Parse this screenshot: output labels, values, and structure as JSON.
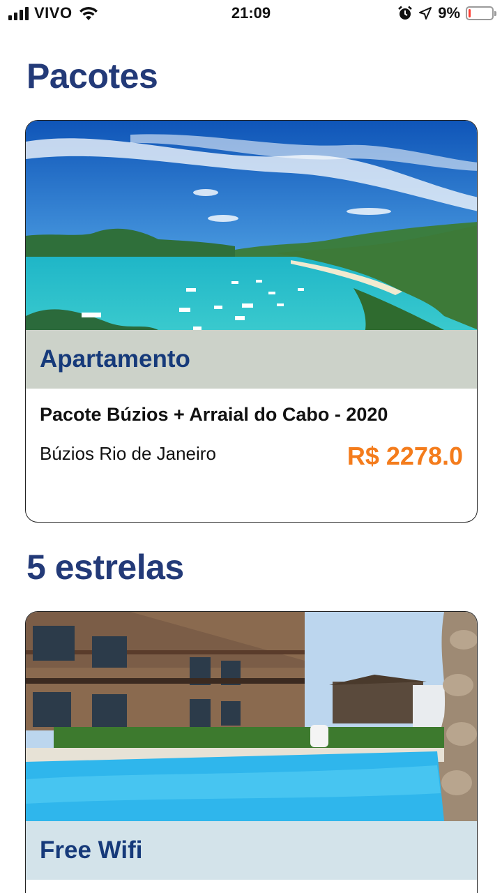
{
  "status_bar": {
    "carrier": "VIVO",
    "time": "21:09",
    "battery_percent": "9%",
    "battery_level": 0.09,
    "icons": [
      "signal-icon",
      "wifi-icon",
      "alarm-icon",
      "location-arrow-icon",
      "battery-icon"
    ]
  },
  "sections": [
    {
      "title": "Pacotes",
      "card": {
        "badge": "Apartamento",
        "title": "Pacote Búzios + Arraial do Cabo - 2020",
        "location": "Búzios Rio de Janeiro",
        "price": "R$ 2278.0"
      }
    },
    {
      "title": "5 estrelas",
      "card": {
        "badge": "Free Wifi"
      }
    }
  ],
  "colors": {
    "title": "#233a78",
    "badge_text": "#163a7a",
    "price": "#f47c1c",
    "battery_low": "#ff3b30"
  }
}
